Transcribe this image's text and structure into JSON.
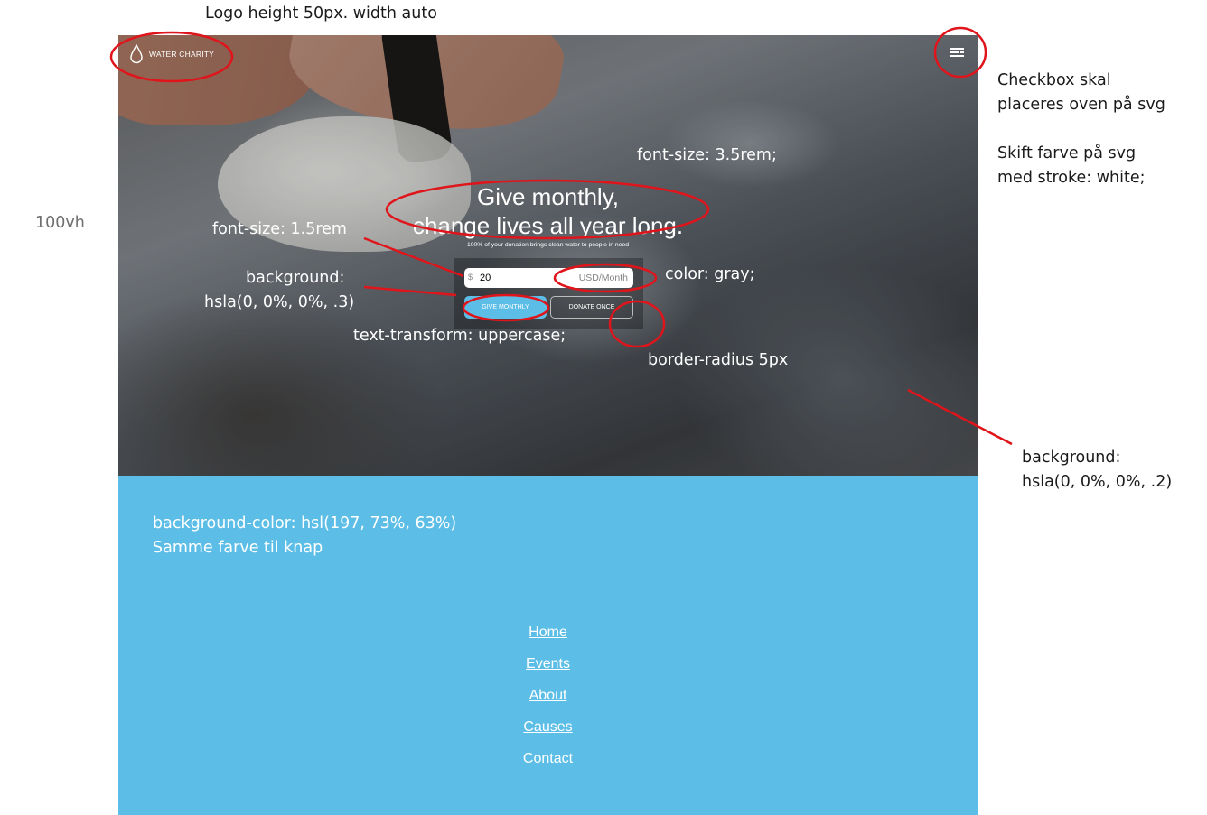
{
  "notes": {
    "logo_spec": "Logo height 50px. width auto",
    "checkbox_line1": "Checkbox skal",
    "checkbox_line2": "placeres oven på svg",
    "svg_line1": "Skift farve på svg",
    "svg_line2": "med stroke: white;",
    "height_label": "100vh",
    "headline_font": "font-size: 3.5rem;",
    "sub_font": "font-size: 1.5rem",
    "box_bg_line1": "background:",
    "box_bg_line2": "hsla(0, 0%, 0%, .3)",
    "unit_color": "color: gray;",
    "text_transform": "text-transform: uppercase;",
    "border_radius": "border-radius 5px",
    "hero_bg_line1": "background:",
    "hero_bg_line2": "hsla(0, 0%, 0%, .2)",
    "blue_line1": "background-color: hsl(197, 73%, 63%)",
    "blue_line2": "Samme farve til knap"
  },
  "logo": {
    "name": "WATER CHARITY",
    "icon": "water-drop-icon"
  },
  "menu": {
    "icon": "hamburger-menu-icon"
  },
  "hero": {
    "headline_line1": "Give monthly,",
    "headline_line2": "change lives all year long.",
    "subtitle": "100% of your donation brings clean water to people in need"
  },
  "donation": {
    "currency": "$",
    "amount": "20",
    "unit": "USD/Month",
    "give_monthly": "give monthly",
    "donate_once": "donate once"
  },
  "nav": {
    "items": [
      {
        "label": "Home"
      },
      {
        "label": "Events"
      },
      {
        "label": "About"
      },
      {
        "label": "Causes"
      },
      {
        "label": "Contact"
      }
    ]
  },
  "colors": {
    "brand_blue": "hsl(197, 73%, 63%)",
    "annotation_red": "#e0141b",
    "form_bg": "hsla(0, 0%, 0%, .3)",
    "hero_overlay": "hsla(0, 0%, 0%, .2)"
  }
}
